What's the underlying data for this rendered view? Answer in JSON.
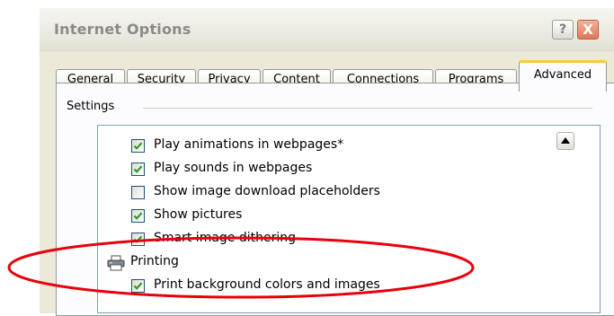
{
  "dialog": {
    "title": "Internet Options",
    "help_button": "?",
    "close_button": "X"
  },
  "tabs": [
    {
      "label": "General"
    },
    {
      "label": "Security"
    },
    {
      "label": "Privacy"
    },
    {
      "label": "Content"
    },
    {
      "label": "Connections"
    },
    {
      "label": "Programs"
    },
    {
      "label": "Advanced",
      "active": true
    }
  ],
  "settings": {
    "group_label": "Settings",
    "items": [
      {
        "label": "Play animations in webpages*",
        "checked": true
      },
      {
        "label": "Play sounds in webpages",
        "checked": true
      },
      {
        "label": "Show image download placeholders",
        "checked": false
      },
      {
        "label": "Show pictures",
        "checked": true
      },
      {
        "label": "Smart image dithering",
        "checked": true
      }
    ],
    "category": {
      "label": "Printing",
      "icon": "printer-icon"
    },
    "printing_items": [
      {
        "label": "Print background colors and images",
        "checked": true
      }
    ]
  },
  "annotation": {
    "color": "#e8000b",
    "shape": "ellipse"
  }
}
